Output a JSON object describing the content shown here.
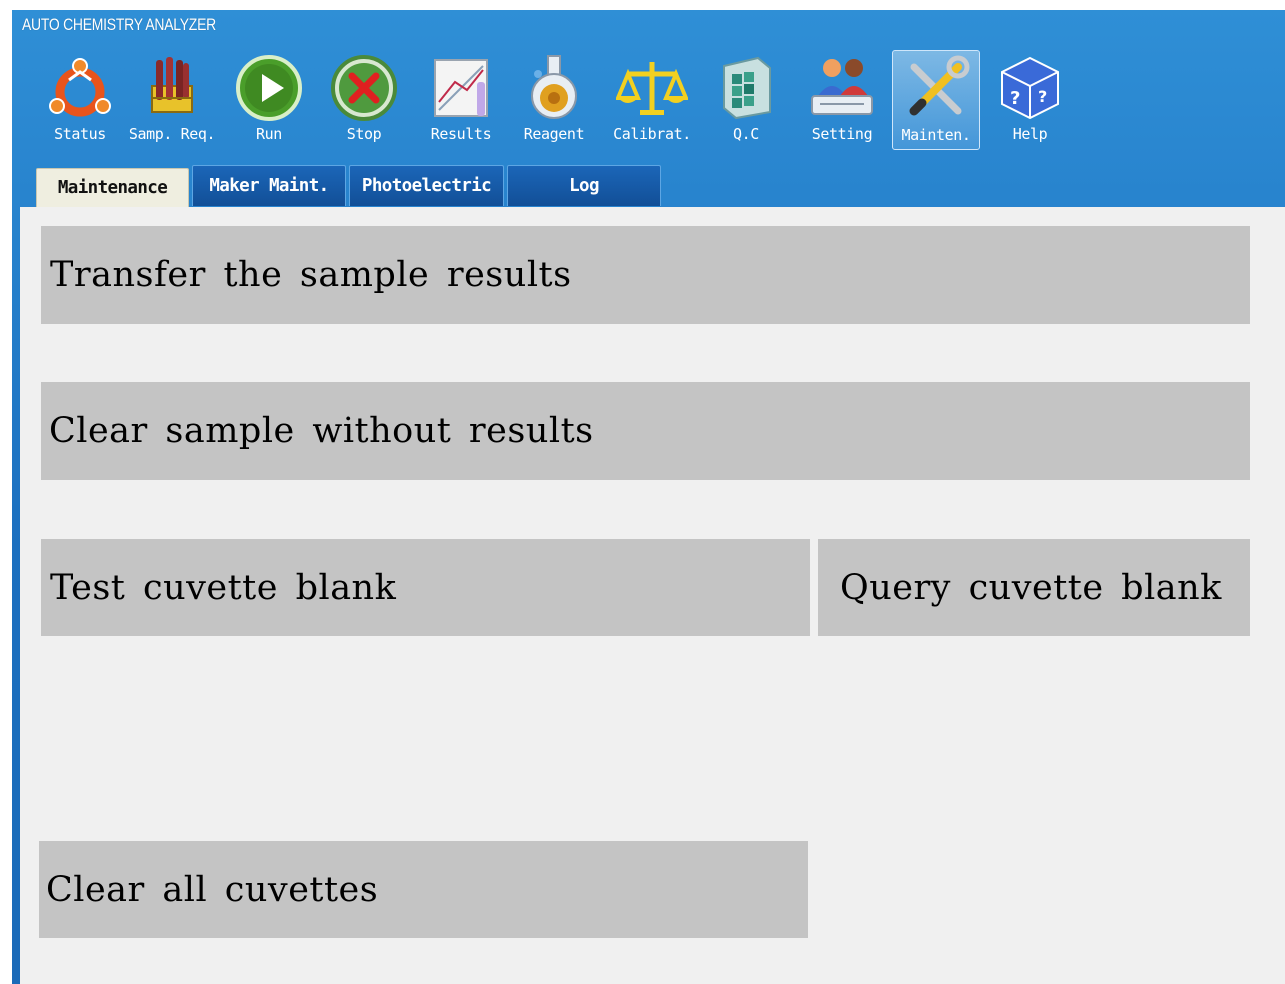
{
  "window": {
    "title": "AUTO CHEMISTRY ANALYZER"
  },
  "toolbar": {
    "items": [
      {
        "label": "Status",
        "icon": "status-icon"
      },
      {
        "label": "Samp. Req.",
        "icon": "sample-tubes-icon"
      },
      {
        "label": "Run",
        "icon": "play-icon"
      },
      {
        "label": "Stop",
        "icon": "stop-icon"
      },
      {
        "label": "Results",
        "icon": "results-chart-icon"
      },
      {
        "label": "Reagent",
        "icon": "flask-icon"
      },
      {
        "label": "Calibrat.",
        "icon": "balance-scale-icon"
      },
      {
        "label": "Q.C",
        "icon": "qc-cube-icon"
      },
      {
        "label": "Setting",
        "icon": "users-setting-icon"
      },
      {
        "label": "Mainten.",
        "icon": "tools-icon"
      },
      {
        "label": "Help",
        "icon": "help-cube-icon"
      }
    ],
    "active": "Mainten."
  },
  "tabs": [
    {
      "label": "Maintenance",
      "active": true
    },
    {
      "label": "Maker Maint.",
      "active": false
    },
    {
      "label": "Photoelectric",
      "active": false
    },
    {
      "label": "Log",
      "active": false
    }
  ],
  "actions": {
    "transfer": "Transfer the sample results",
    "clear_without_results": "Clear sample without results",
    "test_blank": "Test cuvette blank",
    "query_blank": "Query cuvette blank",
    "clear_all": "Clear all cuvettes"
  },
  "colors": {
    "title_bar": "#1f77c6",
    "content_bg": "#f0f0f0",
    "button_bg": "#c4c4c4",
    "active_tab_bg": "#efeee0"
  }
}
